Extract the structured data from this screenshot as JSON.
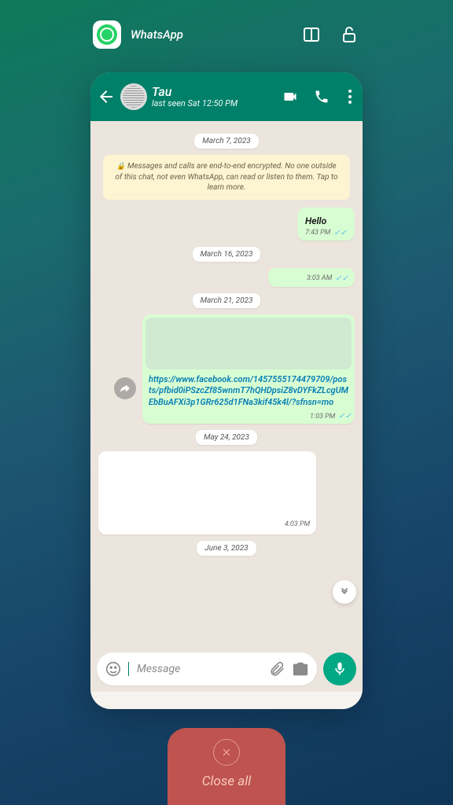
{
  "task": {
    "app_name": "WhatsApp"
  },
  "header": {
    "contact_name": "Tau",
    "last_seen": "last seen Sat 12:50 PM"
  },
  "encryption_notice": "Messages and calls are end-to-end encrypted. No one outside of this chat, not even WhatsApp, can read or listen to them. Tap to learn more.",
  "dates": {
    "d1": "March 7, 2023",
    "d2": "March 16, 2023",
    "d3": "March 21, 2023",
    "d4": "May 24, 2023",
    "d5": "June 3, 2023"
  },
  "messages": {
    "hello": {
      "text": "Hello",
      "time": "7:43 PM"
    },
    "m2": {
      "time": "3:03 AM"
    },
    "link": {
      "url": "https://www.facebook.com/1457555174479709/posts/pfbid0iPSzcZf85wnmT7hQHDpsiZ8vDYFkZLcgUMEbBuAFXi3p1GRr625d1FNa3kif45k4l/?sfnsn=mo",
      "time": "1:03 PM"
    },
    "m4": {
      "time": "4:03 PM"
    }
  },
  "input": {
    "placeholder": "Message"
  },
  "close_all": {
    "label": "Close all"
  }
}
